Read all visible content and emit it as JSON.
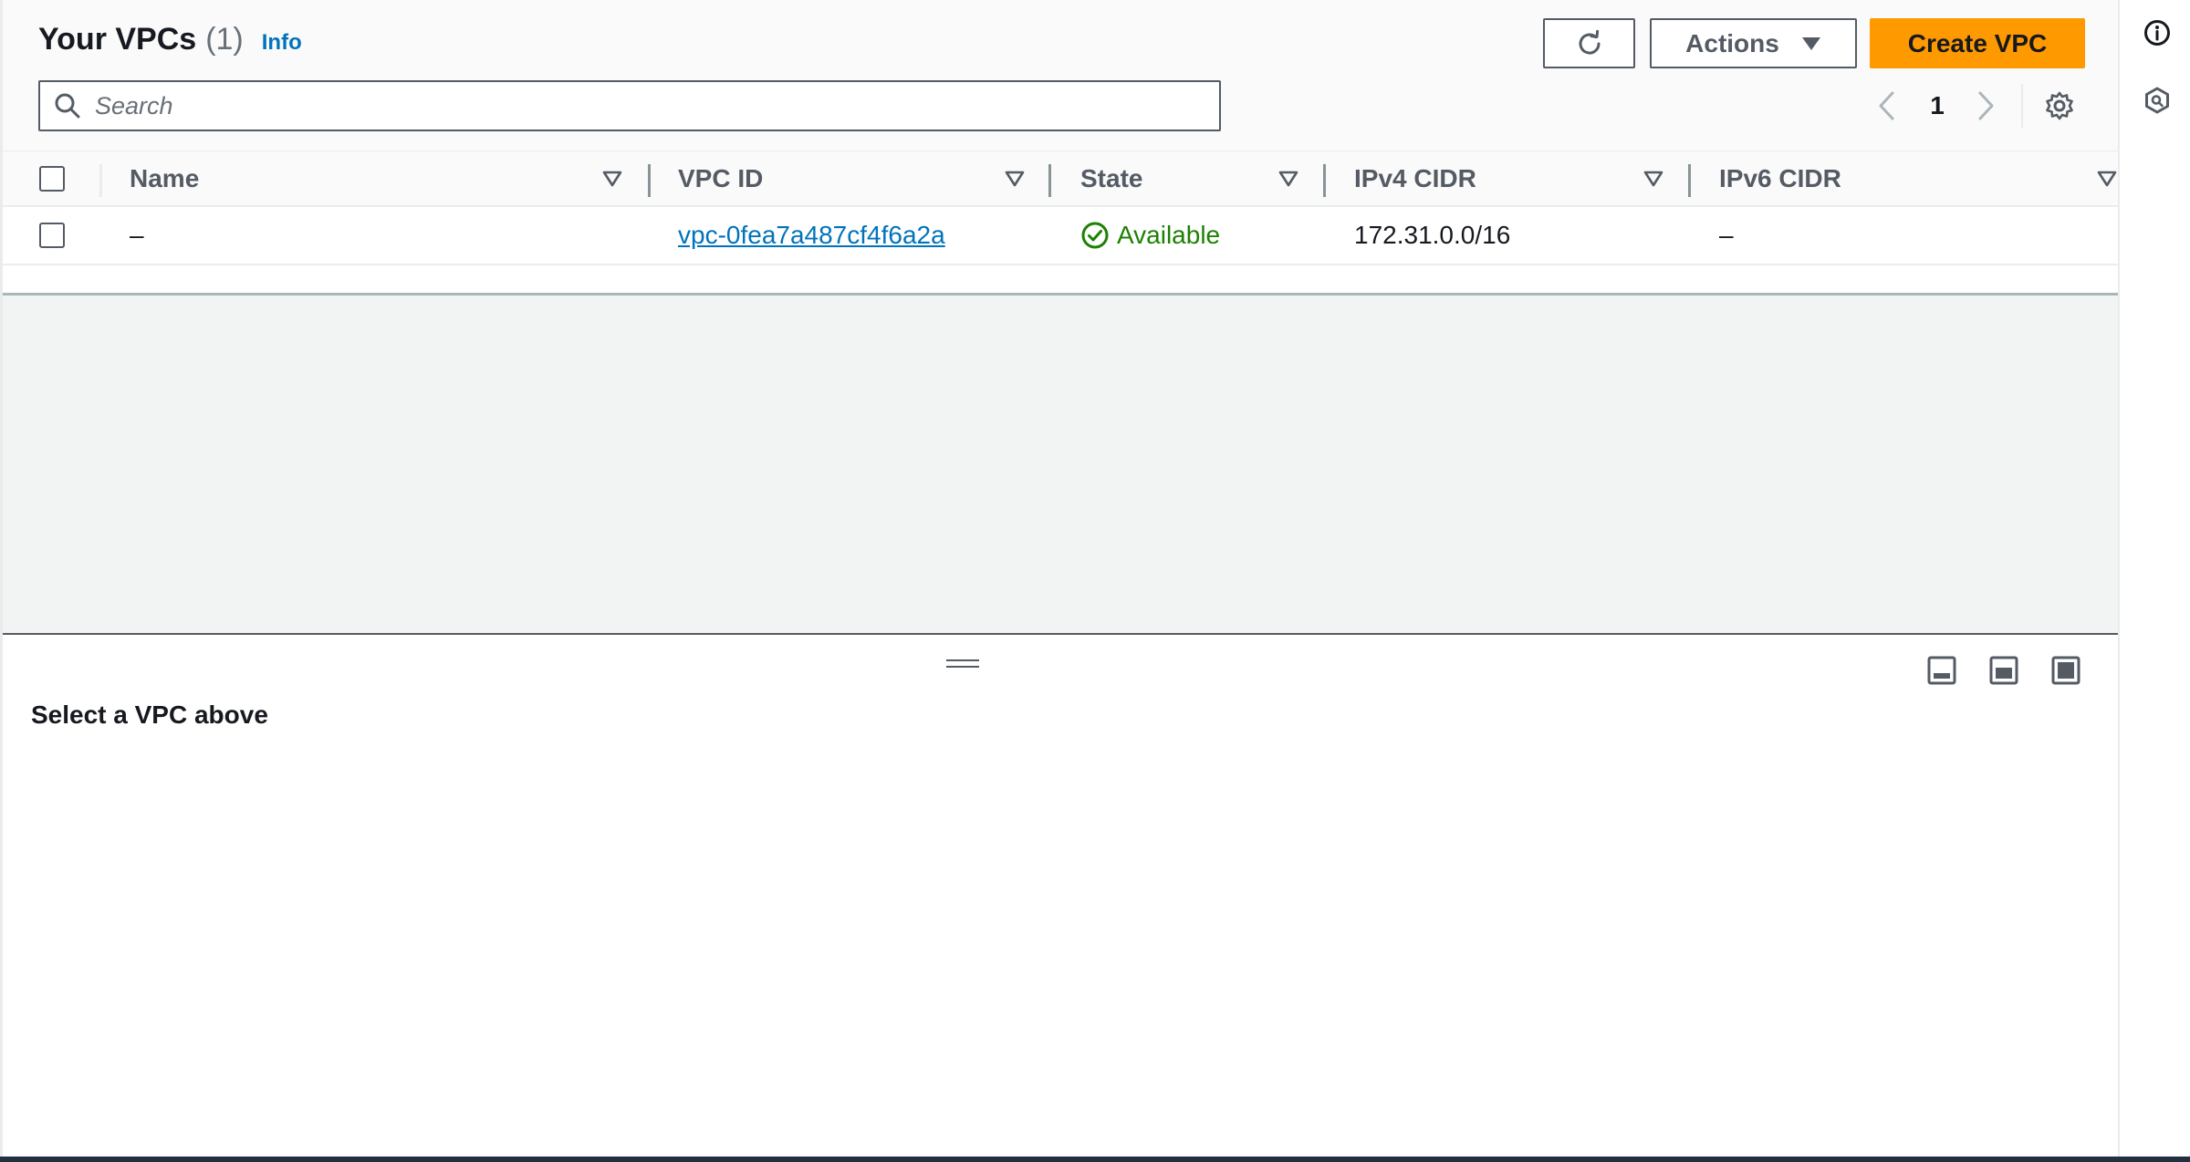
{
  "header": {
    "title": "Your VPCs",
    "count": "(1)",
    "info_label": "Info"
  },
  "toolbar": {
    "refresh_icon": "refresh-icon",
    "actions_label": "Actions",
    "create_label": "Create VPC"
  },
  "search": {
    "placeholder": "Search",
    "value": ""
  },
  "pagination": {
    "current_page": "1"
  },
  "table": {
    "columns": [
      "Name",
      "VPC ID",
      "State",
      "IPv4 CIDR",
      "IPv6 CIDR"
    ],
    "rows": [
      {
        "name": "–",
        "vpc_id": "vpc-0fea7a487cf4f6a2a",
        "state": "Available",
        "ipv4_cidr": "172.31.0.0/16",
        "ipv6_cidr": "–"
      }
    ]
  },
  "details": {
    "message": "Select a VPC above"
  },
  "colors": {
    "primary_button": "#ff9900",
    "link": "#0073bb",
    "success": "#1d8102",
    "text": "#16191f",
    "muted": "#545b64"
  },
  "icons": {
    "search": "search-icon",
    "settings": "gear-icon",
    "info": "info-icon",
    "notifications": "hexagon-icon"
  }
}
